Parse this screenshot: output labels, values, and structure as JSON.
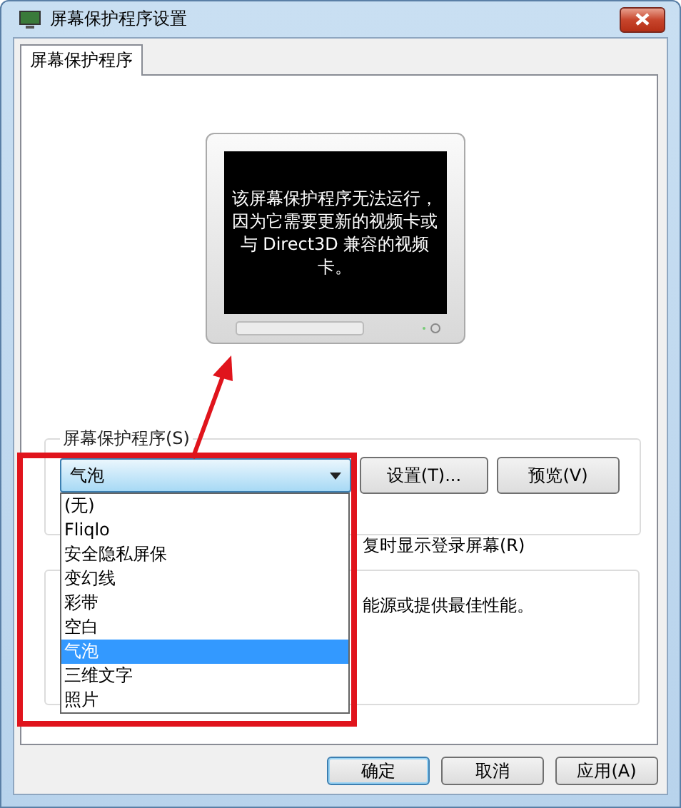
{
  "window": {
    "title": "屏幕保护程序设置"
  },
  "tabs": [
    {
      "label": "屏幕保护程序",
      "selected": true
    }
  ],
  "preview": {
    "message": "该屏幕保护程序无法运行，因为它需要更新的视频卡或与 Direct3D 兼容的视频卡。"
  },
  "screensaver_group": {
    "label": "屏幕保护程序(S)",
    "value": "气泡",
    "expanded": true,
    "options": [
      {
        "label": "(无)",
        "selected": false
      },
      {
        "label": "Fliqlo",
        "selected": false
      },
      {
        "label": "安全隐私屏保",
        "selected": false
      },
      {
        "label": "变幻线",
        "selected": false
      },
      {
        "label": "彩带",
        "selected": false
      },
      {
        "label": "空白",
        "selected": false
      },
      {
        "label": "气泡",
        "selected": true
      },
      {
        "label": "三维文字",
        "selected": false
      },
      {
        "label": "照片",
        "selected": false
      }
    ],
    "buttons": [
      "设置(T)...",
      "预览(V)"
    ],
    "resume_text": "复时显示登录屏幕(R)"
  },
  "power_group": {
    "text": "能源或提供最佳性能。"
  },
  "buttons": [
    {
      "label": "确定",
      "default": true
    },
    {
      "label": "取消",
      "default": false
    },
    {
      "label": "应用(A)",
      "default": false
    }
  ]
}
